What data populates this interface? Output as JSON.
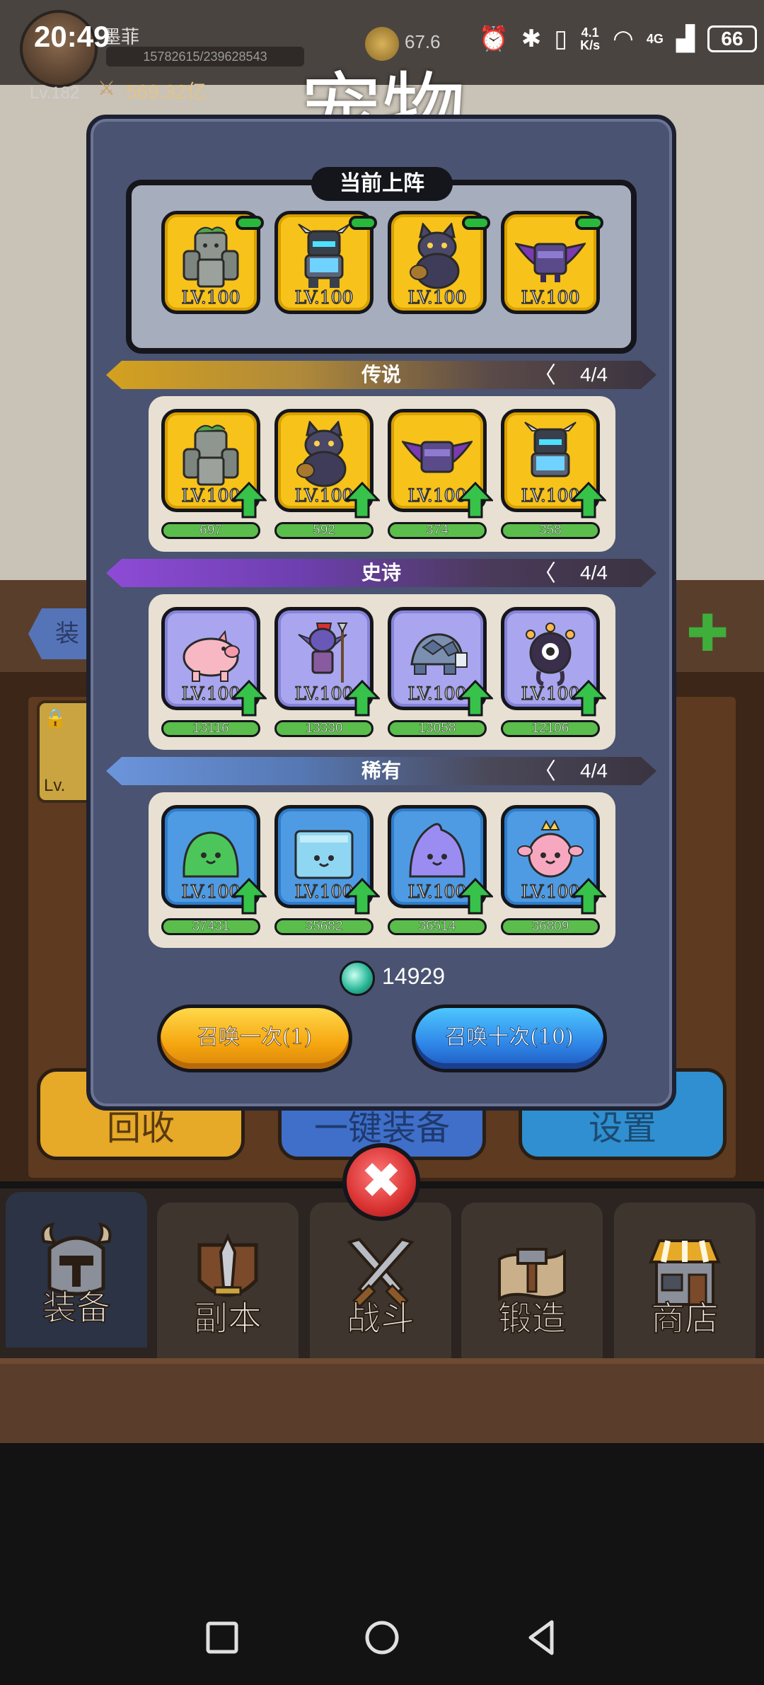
{
  "status_bar": {
    "time": "20:49",
    "net_speed_value": "4.1",
    "net_speed_unit": "K/s",
    "signal_label": "4G",
    "battery": "66"
  },
  "screen_title": "宠物",
  "player": {
    "name": "墨菲",
    "exp": "15782615/239628543",
    "level": "Lv.182",
    "power": "569.32亿",
    "coins": "67.6"
  },
  "background": {
    "equip_tab": "装",
    "slot_level": "Lv.",
    "buttons": [
      "回收",
      "一键装备",
      "设置"
    ],
    "bottom_nav": [
      {
        "label": "装备",
        "icon": "helmet-icon"
      },
      {
        "label": "副本",
        "icon": "sword-shield-icon"
      },
      {
        "label": "战斗",
        "icon": "crossed-swords-icon"
      },
      {
        "label": "锻造",
        "icon": "hammer-scroll-icon"
      },
      {
        "label": "商店",
        "icon": "shop-icon"
      }
    ]
  },
  "dialog": {
    "lineup_label": "当前上阵",
    "lineup": [
      {
        "name": "golem",
        "level": "LV.100"
      },
      {
        "name": "knight",
        "level": "LV.100"
      },
      {
        "name": "werewolf",
        "level": "LV.100"
      },
      {
        "name": "bat",
        "level": "LV.100"
      }
    ],
    "sections": [
      {
        "key": "legend",
        "title": "传说",
        "count": "4/4",
        "pets": [
          {
            "name": "golem",
            "level": "LV.100",
            "shards": "697"
          },
          {
            "name": "werewolf",
            "level": "LV.100",
            "shards": "592"
          },
          {
            "name": "bat",
            "level": "LV.100",
            "shards": "374"
          },
          {
            "name": "knight",
            "level": "LV.100",
            "shards": "358"
          }
        ]
      },
      {
        "key": "epic",
        "title": "史诗",
        "count": "4/4",
        "pets": [
          {
            "name": "pig",
            "level": "LV.100",
            "shards": "13116"
          },
          {
            "name": "goblin",
            "level": "LV.100",
            "shards": "13330"
          },
          {
            "name": "turtle",
            "level": "LV.100",
            "shards": "13058"
          },
          {
            "name": "beholder",
            "level": "LV.100",
            "shards": "12106"
          }
        ]
      },
      {
        "key": "rare",
        "title": "稀有",
        "count": "4/4",
        "pets": [
          {
            "name": "green-slime",
            "level": "LV.100",
            "shards": "37431"
          },
          {
            "name": "cube-slime",
            "level": "LV.100",
            "shards": "35682"
          },
          {
            "name": "purple-slime",
            "level": "LV.100",
            "shards": "36514"
          },
          {
            "name": "pink-slime",
            "level": "LV.100",
            "shards": "36809"
          }
        ]
      }
    ],
    "gems": "14929",
    "summon_once": "召唤一次(1)",
    "summon_ten": "召唤十次(10)",
    "close": "✖"
  },
  "colors": {
    "legend": "#f7c21a",
    "epic": "#a9a6ef",
    "rare": "#4e9be4",
    "green": "#5bbd4b"
  }
}
